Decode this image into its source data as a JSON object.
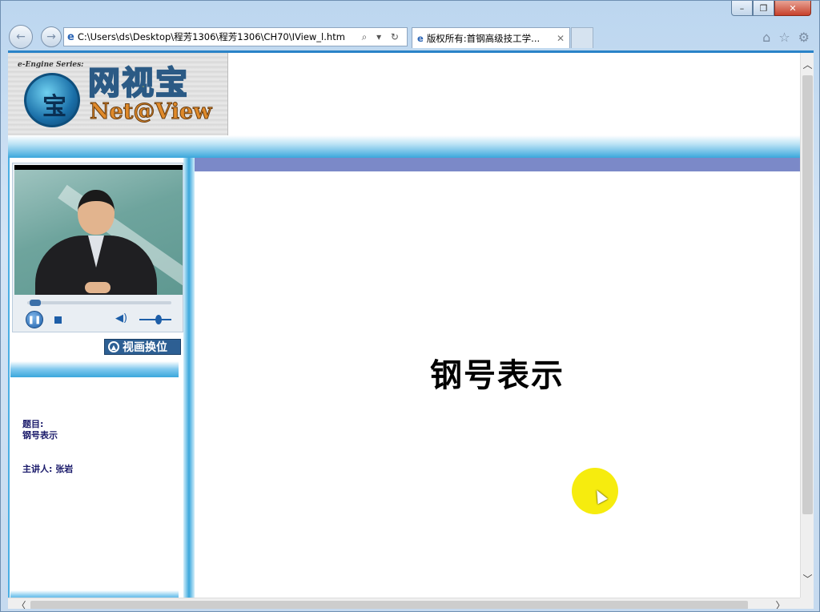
{
  "window": {
    "minimize_glyph": "–",
    "restore_glyph": "❐",
    "close_glyph": "✕"
  },
  "navbar": {
    "back_glyph": "←",
    "forward_glyph": "→",
    "address_url": "C:\\Users\\ds\\Desktop\\程芳1306\\程芳1306\\CH70\\IView_l.htm",
    "address_tools": "⌕ ▾ ↻",
    "tab_title": "版权所有:首钢高级技工学...",
    "tab_close": "✕",
    "home_glyph": "⌂",
    "favorites_glyph": "☆",
    "settings_glyph": "⚙"
  },
  "banner": {
    "series": "e-Engine Series:",
    "title": "网视宝",
    "subtitle": "Net@View",
    "globe_glyph": "宝"
  },
  "player": {
    "pause_glyph": "❚❚",
    "volume_glyph": "◀)",
    "progress_fraction": 0.02,
    "volume_fraction": 0.6
  },
  "left_panel": {
    "swap_label": "视画换位",
    "swap_glyph": "▲",
    "topic_label": "题目:",
    "topic_value": "钢号表示",
    "presenter": "主讲人: 张岩"
  },
  "main": {
    "slide_title": "钢号表示"
  },
  "scrollbars": {
    "up": "︿",
    "down": "﹀",
    "left": "〈",
    "right": "〉"
  },
  "colors": {
    "accent_blue": "#3aa7dc",
    "main_band": "#7b89c8",
    "cursor_highlight": "#f6ec0e"
  }
}
